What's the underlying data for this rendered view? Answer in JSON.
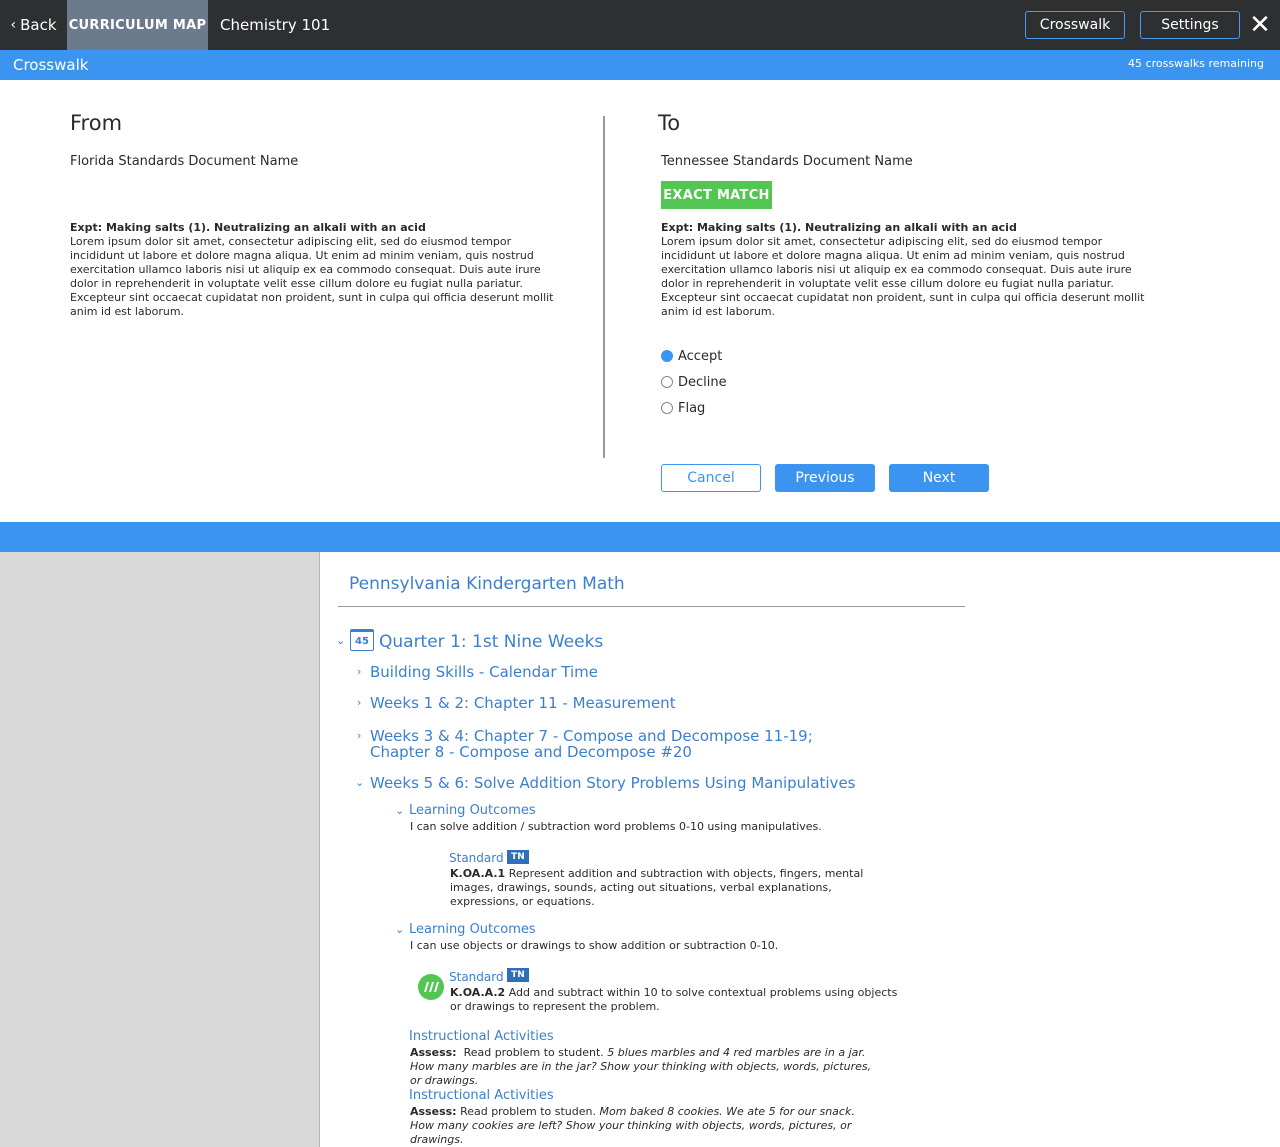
{
  "topbar": {
    "back_label": "Back",
    "curriculum_map_label": "CURRICULUM MAP",
    "course_name": "Chemistry 101",
    "crosswalk_button": "Crosswalk",
    "settings_button": "Settings",
    "close_glyph": "✕"
  },
  "crosswalk_bar": {
    "title": "Crosswalk",
    "remaining": "45 crosswalks remaining"
  },
  "from": {
    "heading": "From",
    "document_name": "Florida Standards Document Name",
    "expectation_title": "Expt: Making salts (1). Neutralizing an alkali with an acid",
    "expectation_body": "Lorem ipsum dolor sit amet, consectetur adipiscing elit, sed do eiusmod tempor incididunt ut labore et dolore magna aliqua. Ut enim ad minim veniam, quis nostrud exercitation ullamco laboris nisi ut aliquip ex ea commodo consequat. Duis aute irure dolor in reprehenderit in voluptate velit esse cillum dolore eu fugiat nulla pariatur. Excepteur sint occaecat cupidatat non proident, sunt in culpa qui officia deserunt mollit anim id est laborum."
  },
  "to": {
    "heading": "To",
    "document_name": "Tennessee Standards Document Name",
    "match_badge": "EXACT MATCH",
    "expectation_title": "Expt: Making salts (1). Neutralizing an alkali with an acid",
    "expectation_body": "Lorem ipsum dolor sit amet, consectetur adipiscing elit, sed do eiusmod tempor incididunt ut labore et dolore magna aliqua. Ut enim ad minim veniam, quis nostrud exercitation ullamco laboris nisi ut aliquip ex ea commodo consequat. Duis aute irure dolor in reprehenderit in voluptate velit esse cillum dolore eu fugiat nulla pariatur. Excepteur sint occaecat cupidatat non proident, sunt in culpa qui officia deserunt mollit anim id est laborum.",
    "options": [
      {
        "label": "Accept",
        "selected": true
      },
      {
        "label": "Decline",
        "selected": false
      },
      {
        "label": "Flag",
        "selected": false
      }
    ],
    "buttons": {
      "cancel": "Cancel",
      "previous": "Previous",
      "next": "Next"
    }
  },
  "curriculum": {
    "title": "Pennsylvania Kindergarten Math",
    "quarter": {
      "calendar_number": "45",
      "title": "Quarter 1: 1st Nine Weeks"
    },
    "units": [
      {
        "title": "Building Skills - Calendar Time"
      },
      {
        "title": "Weeks 1 & 2: Chapter 11 - Measurement"
      },
      {
        "title_line1": "Weeks 3 & 4: Chapter 7 - Compose and Decompose 11-19;",
        "title_line2": "Chapter 8 - Compose and Decompose #20"
      },
      {
        "title": "Weeks 5 & 6: Solve Addition Story Problems Using Manipulatives"
      }
    ],
    "learning_outcomes": [
      {
        "heading": "Learning Outcomes",
        "text": "I can solve addition / subtraction word problems 0-10 using manipulatives.",
        "standard_label": "Standard",
        "state_badge": "TN",
        "code": "K.OA.A.1",
        "description": "Represent addition and subtraction with objects, fingers, mental images, drawings, sounds, acting out situations, verbal explanations, expressions, or equations."
      },
      {
        "heading": "Learning Outcomes",
        "text": "I can use objects or drawings to show addition or subtraction 0-10.",
        "standard_label": "Standard",
        "state_badge": "TN",
        "code": "K.OA.A.2",
        "description": "Add and subtract within 10 to solve contextual problems using objects or drawings to represent the problem."
      }
    ],
    "instructional_activities": [
      {
        "heading": "Instructional Activities",
        "assess_label": "Assess:",
        "lead": "Read problem to student.",
        "problem": "5 blues marbles and 4 red marbles are in a jar.  How many marbles are in the jar? Show your thinking with objects, words, pictures, or drawings."
      },
      {
        "heading": "Instructional Activities",
        "assess_label": "Assess:",
        "lead": "Read problem to studen.",
        "problem": "Mom baked 8 cookies.  We ate 5 for our snack.  How many cookies are left? Show your thinking with objects, words, pictures, or drawings."
      }
    ]
  }
}
